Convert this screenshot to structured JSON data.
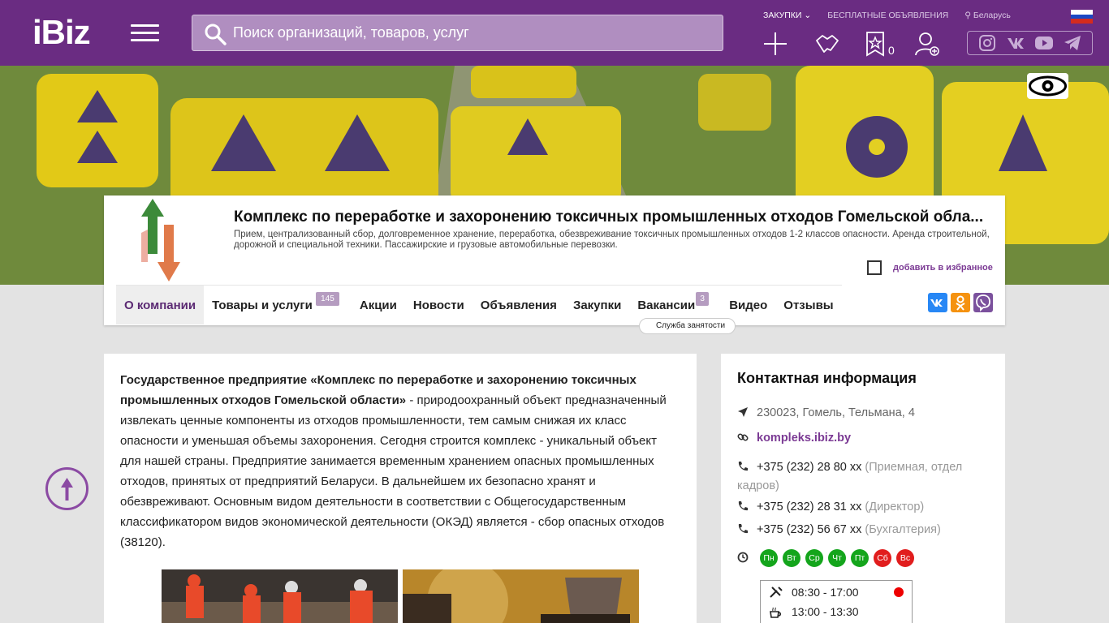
{
  "header": {
    "logo": "iBiz",
    "search": {
      "placeholder": "Поиск организаций, товаров, услуг"
    },
    "top_links": {
      "purchases": "ЗАКУПКИ",
      "free_ads": "БЕСПЛАТНЫЕ ОБЪЯВЛЕНИЯ",
      "region": "Беларусь"
    },
    "favorites_count": "0",
    "icons": [
      "add-icon",
      "handshake-icon",
      "star-bookmark-icon",
      "user-add-icon"
    ],
    "social": [
      "instagram-icon",
      "vk-icon",
      "youtube-icon",
      "telegram-icon"
    ]
  },
  "company": {
    "title": "Комплекс по переработке и захоронению токсичных промышленных отходов Гомельской обла...",
    "description": "Прием, централизованный сбор, долговременное хранение, переработка, обезвреживание токсичных промышленных отходов 1-2 классов опасности. Аренда строительной, дорожной и специальной техники. Пассажирские и грузовые автомобильные перевозки.",
    "add_favorite": "добавить в избранное"
  },
  "nav": {
    "items": [
      {
        "label": "О компании",
        "active": true
      },
      {
        "label": "Товары и услуги",
        "badge": "145"
      },
      {
        "label": "Акции"
      },
      {
        "label": "Новости"
      },
      {
        "label": "Объявления"
      },
      {
        "label": "Закупки"
      },
      {
        "label": "Вакансии",
        "badge": "3"
      },
      {
        "label": "Видео"
      },
      {
        "label": "Отзывы"
      }
    ],
    "employment_tag": "Служба занятости"
  },
  "about": {
    "bold_name": "Государственное предприятие «Комплекс по переработке и захоронению токсичных промышленных отходов Гомельской области»",
    "body": " - природоохранный объект  предназначенный извлекать ценные компоненты из отходов промышленности, тем самым снижая их класс опасности и уменьшая объемы захоронения. Сегодня строится  комплекс - уникальный объект для нашей страны.  Предприятие занимается  временным хранением опасных промышленных отходов, принятых от предприятий Беларуси. В дальнейшем их безопасно хранят и обезвреживают.  Основным видом деятельности в соответствии с Общегосударственным классификатором видов экономической деятельности (ОКЭД) является - сбор опасных отходов (38120)."
  },
  "contacts": {
    "title": "Контактная информация",
    "address": "230023, Гомель, Тельмана, 4",
    "website": "kompleks.ibiz.by",
    "phones": [
      {
        "number": "+375 (232) 28 80 xx",
        "note": "(Приемная, отдел кадров)"
      },
      {
        "number": "+375 (232) 28 31 xx",
        "note": "(Директор)"
      },
      {
        "number": "+375 (232) 56 67 xx",
        "note": "(Бухгалтерия)"
      }
    ],
    "days": [
      {
        "label": "Пн",
        "open": true
      },
      {
        "label": "Вт",
        "open": true
      },
      {
        "label": "Ср",
        "open": true
      },
      {
        "label": "Чт",
        "open": true
      },
      {
        "label": "Пт",
        "open": true
      },
      {
        "label": "Сб",
        "open": false
      },
      {
        "label": "Вс",
        "open": false
      }
    ],
    "work_hours": "08:30 - 17:00",
    "break_hours": "13:00 - 13:30"
  },
  "colors": {
    "brand": "#6a2c82",
    "accent": "#7b3a94",
    "open": "#14a51c",
    "closed": "#e11d1d"
  }
}
